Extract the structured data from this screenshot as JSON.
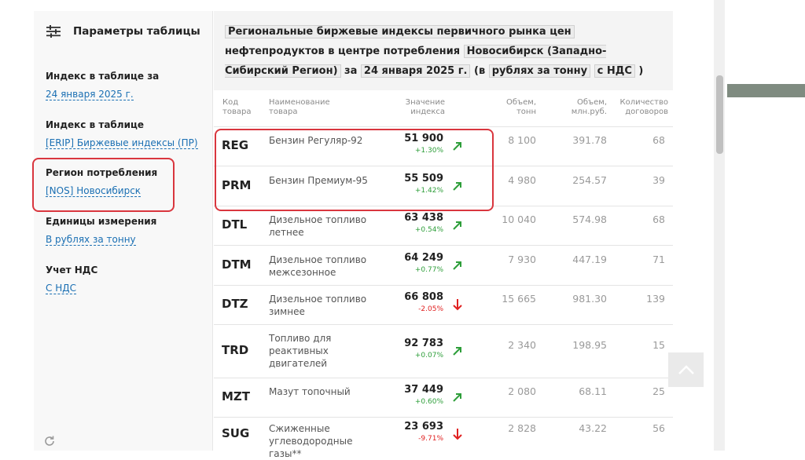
{
  "sidebar": {
    "title": "Параметры таблицы",
    "groups": [
      {
        "label": "Индекс в таблице за",
        "value": "24 января 2025 г."
      },
      {
        "label": "Индекс в таблице",
        "value": "[ERIP] Биржевые индексы (ПР)"
      },
      {
        "label": "Регион потребления",
        "value": "[NOS] Новосибирск"
      },
      {
        "label": "Единицы измерения",
        "value": "В рублях за тонну"
      },
      {
        "label": "Учет НДС",
        "value": "С НДС"
      }
    ]
  },
  "header": {
    "chip1": "Региональные биржевые индексы первичного рынка цен",
    "t1": "нефтепродуктов в центре потребления",
    "chip2": "Новосибирск (Западно-Сибирский Регион)",
    "t2": "за",
    "chip3": "24 января 2025 г.",
    "t3": "(в",
    "chip4": "рублях за тонну",
    "chip5": "с НДС",
    "t4": ")"
  },
  "columns": {
    "code": "Код товара",
    "name": "Наименование товара",
    "value": "Значение индекса",
    "volume": "Объем, тонн",
    "volume_rub": "Объем, млн.руб.",
    "count": "Количество договоров"
  },
  "rows": [
    {
      "code": "REG",
      "name": "Бензин Регуляр-92",
      "value": "51 900",
      "change": "+1.30%",
      "dir": "up",
      "volume": "8 100",
      "volume_rub": "391.78",
      "count": "68"
    },
    {
      "code": "PRM",
      "name": "Бензин Премиум-95",
      "value": "55 509",
      "change": "+1.42%",
      "dir": "up",
      "volume": "4 980",
      "volume_rub": "254.57",
      "count": "39"
    },
    {
      "code": "DTL",
      "name": "Дизельное топливо летнее",
      "value": "63 438",
      "change": "+0.54%",
      "dir": "up",
      "volume": "10 040",
      "volume_rub": "574.98",
      "count": "68"
    },
    {
      "code": "DTM",
      "name": "Дизельное топливо межсезонное",
      "value": "64 249",
      "change": "+0.77%",
      "dir": "up",
      "volume": "7 930",
      "volume_rub": "447.19",
      "count": "71"
    },
    {
      "code": "DTZ",
      "name": "Дизельное топливо зимнее",
      "value": "66 808",
      "change": "-2.05%",
      "dir": "down",
      "volume": "15 665",
      "volume_rub": "981.30",
      "count": "139"
    },
    {
      "code": "TRD",
      "name": "Топливо для реактивных двигателей",
      "value": "92 783",
      "change": "+0.07%",
      "dir": "up",
      "volume": "2 340",
      "volume_rub": "198.95",
      "count": "15"
    },
    {
      "code": "MZT",
      "name": "Мазут топочный",
      "value": "37 449",
      "change": "+0.60%",
      "dir": "up",
      "volume": "2 080",
      "volume_rub": "68.11",
      "count": "25"
    },
    {
      "code": "SUG",
      "name": "Сжиженные углеводородные газы**",
      "value": "23 693",
      "change": "-9.71%",
      "dir": "down",
      "volume": "2 828",
      "volume_rub": "43.22",
      "count": "56"
    }
  ],
  "colors": {
    "up": "#2e9e3a",
    "down": "#e02020",
    "link": "#1a6fb3",
    "highlight": "#d9363e"
  }
}
